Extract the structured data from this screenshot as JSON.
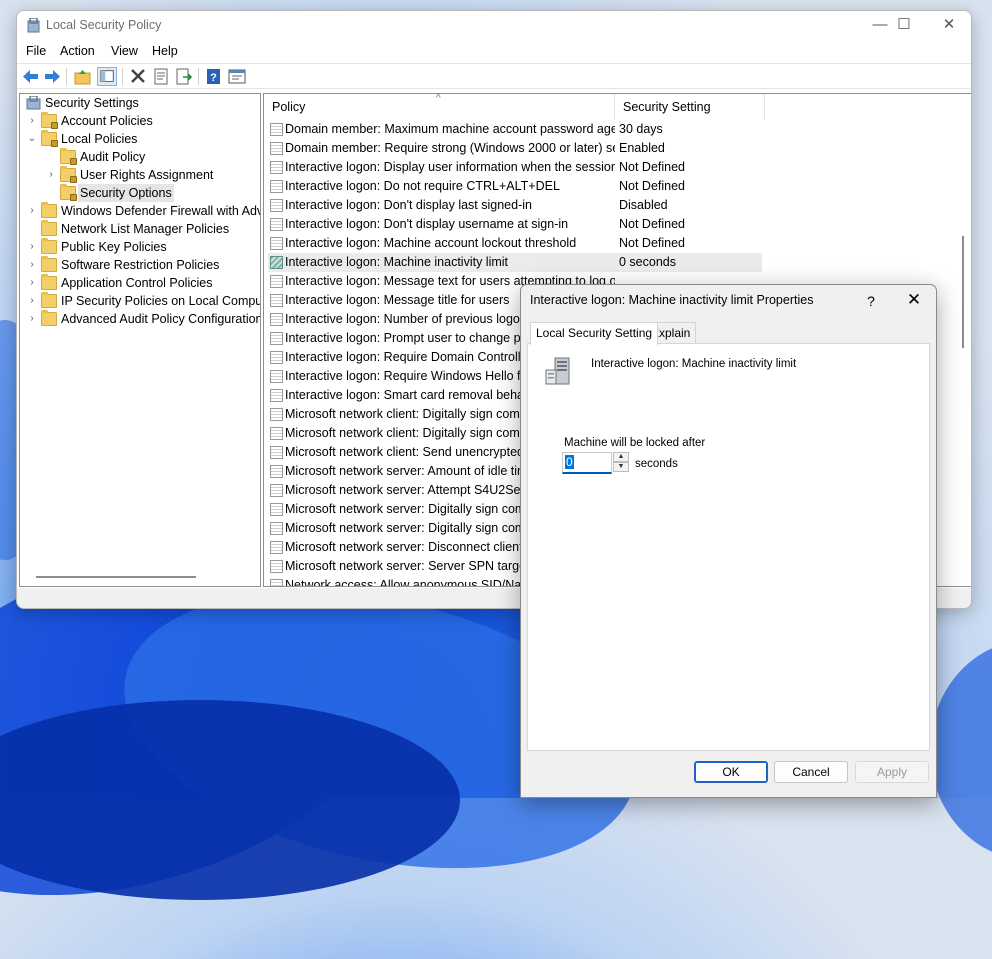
{
  "window": {
    "title": "Local Security Policy",
    "controls": {
      "minimize": "—",
      "maximize": "☐",
      "close": "✕"
    }
  },
  "menu": [
    "File",
    "Action",
    "View",
    "Help"
  ],
  "toolbar": [
    "back-icon",
    "forward-icon",
    "up-folder-icon",
    "show-hide-tree-icon",
    "delete-icon",
    "properties-icon",
    "export-list-icon",
    "help-icon",
    "console-icon"
  ],
  "tree": {
    "root": "Security Settings",
    "items": [
      {
        "label": "Account Policies",
        "expander": "›",
        "level": 1
      },
      {
        "label": "Local Policies",
        "expander": "⌄",
        "level": 1
      },
      {
        "label": "Audit Policy",
        "expander": "",
        "level": 2
      },
      {
        "label": "User Rights Assignment",
        "expander": "›",
        "level": 2
      },
      {
        "label": "Security Options",
        "expander": "",
        "level": 2,
        "selected": true
      },
      {
        "label": "Windows Defender Firewall with Adva",
        "expander": "›",
        "level": 1
      },
      {
        "label": "Network List Manager Policies",
        "expander": "",
        "level": 1
      },
      {
        "label": "Public Key Policies",
        "expander": "›",
        "level": 1
      },
      {
        "label": "Software Restriction Policies",
        "expander": "›",
        "level": 1
      },
      {
        "label": "Application Control Policies",
        "expander": "›",
        "level": 1
      },
      {
        "label": "IP Security Policies on Local Compute",
        "expander": "›",
        "level": 1
      },
      {
        "label": "Advanced Audit Policy Configuration",
        "expander": "›",
        "level": 1
      }
    ]
  },
  "list": {
    "columns": [
      "Policy",
      "Security Setting"
    ],
    "sort_indicator": "^",
    "rows": [
      {
        "policy": "Domain member: Maximum machine account password age",
        "setting": "30 days"
      },
      {
        "policy": "Domain member: Require strong (Windows 2000 or later) se...",
        "setting": "Enabled"
      },
      {
        "policy": "Interactive logon: Display user information when the session...",
        "setting": "Not Defined"
      },
      {
        "policy": "Interactive logon: Do not require CTRL+ALT+DEL",
        "setting": "Not Defined"
      },
      {
        "policy": "Interactive logon: Don't display last signed-in",
        "setting": "Disabled"
      },
      {
        "policy": "Interactive logon: Don't display username at sign-in",
        "setting": "Not Defined"
      },
      {
        "policy": "Interactive logon: Machine account lockout threshold",
        "setting": "Not Defined"
      },
      {
        "policy": "Interactive logon: Machine inactivity limit",
        "setting": "0 seconds",
        "selected": true
      },
      {
        "policy": "Interactive logon: Message text for users attempting to log on",
        "setting": ""
      },
      {
        "policy": "Interactive logon: Message title for users",
        "setting": ""
      },
      {
        "policy": "Interactive logon: Number of previous logon",
        "setting": ""
      },
      {
        "policy": "Interactive logon: Prompt user to change pas",
        "setting": ""
      },
      {
        "policy": "Interactive logon: Require Domain Controller",
        "setting": ""
      },
      {
        "policy": "Interactive logon: Require Windows Hello for",
        "setting": ""
      },
      {
        "policy": "Interactive logon: Smart card removal behav",
        "setting": ""
      },
      {
        "policy": "Microsoft network client: Digitally sign comm",
        "setting": ""
      },
      {
        "policy": "Microsoft network client: Digitally sign comm",
        "setting": ""
      },
      {
        "policy": "Microsoft network client: Send unencrypted",
        "setting": ""
      },
      {
        "policy": "Microsoft network server: Amount of idle tim",
        "setting": ""
      },
      {
        "policy": "Microsoft network server: Attempt S4U2Self f",
        "setting": ""
      },
      {
        "policy": "Microsoft network server: Digitally sign comm",
        "setting": ""
      },
      {
        "policy": "Microsoft network server: Digitally sign comm",
        "setting": ""
      },
      {
        "policy": "Microsoft network server: Disconnect clients",
        "setting": ""
      },
      {
        "policy": "Microsoft network server: Server SPN target n",
        "setting": ""
      },
      {
        "policy": "Network access: Allow anonymous SID/Nam",
        "setting": ""
      }
    ]
  },
  "dialog": {
    "title": "Interactive logon: Machine inactivity limit Properties",
    "help": "?",
    "close": "✕",
    "tabs": [
      "Local Security Setting",
      "Explain"
    ],
    "active_tab": 0,
    "policy_name": "Interactive logon: Machine inactivity limit",
    "field_label": "Machine will be locked after",
    "value": "0",
    "unit": "seconds",
    "spin_up": "▲",
    "spin_down": "▼",
    "buttons": {
      "ok": "OK",
      "cancel": "Cancel",
      "apply": "Apply"
    }
  },
  "colors": {
    "accent": "#0078d7",
    "selection": "#e5e5e5",
    "default_button_border": "#1e63c4"
  }
}
